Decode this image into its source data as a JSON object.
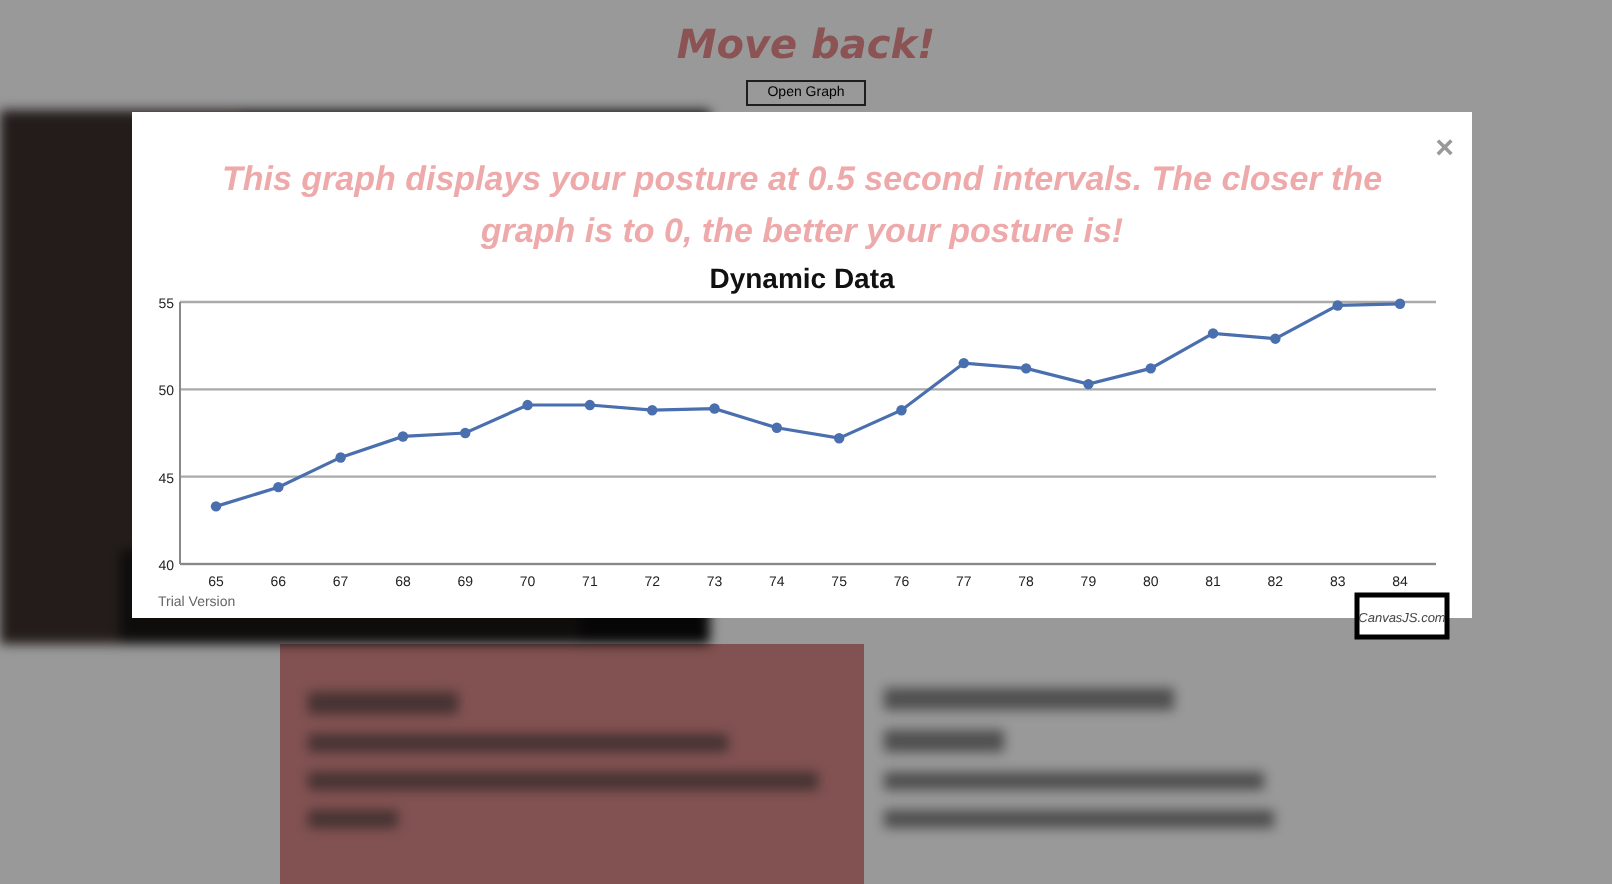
{
  "page": {
    "heading": "Move back!",
    "open_button": "Open Graph"
  },
  "modal": {
    "close": "×",
    "message": "This graph displays your posture at 0.5 second intervals. The closer the graph is to 0, the better your posture is!",
    "chart": {
      "trial_label": "Trial Version",
      "credit": "CanvasJS.com",
      "chart_data": {
        "type": "line",
        "title": "Dynamic Data",
        "categories": [
          "65",
          "66",
          "67",
          "68",
          "69",
          "70",
          "71",
          "72",
          "73",
          "74",
          "75",
          "76",
          "77",
          "78",
          "79",
          "80",
          "81",
          "82",
          "83",
          "84"
        ],
        "series": [
          {
            "color": "#4a6fae",
            "marker": "circle",
            "values": [
              43.3,
              44.4,
              46.1,
              47.3,
              47.5,
              49.1,
              49.1,
              48.8,
              48.9,
              47.8,
              47.2,
              48.8,
              51.5,
              51.2,
              50.3,
              51.2,
              53.2,
              52.9,
              54.8,
              54.9
            ]
          }
        ],
        "ylim": [
          40,
          55
        ],
        "yticks": [
          40,
          45,
          50,
          55
        ]
      }
    }
  }
}
